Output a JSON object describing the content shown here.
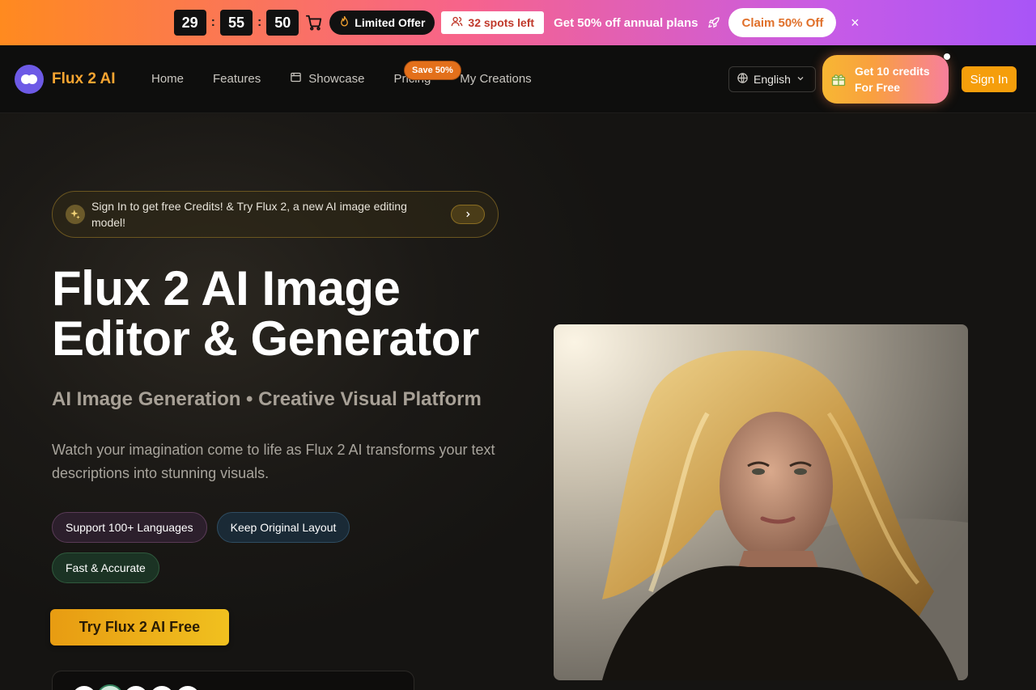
{
  "promo": {
    "timer": {
      "hours": "29",
      "minutes": "55",
      "seconds": "50",
      "separator": ":"
    },
    "offer_label": "Limited Offer",
    "spots_label": "32 spots left",
    "discount_text": "Get 50% off annual plans",
    "claim_label": "Claim 50% Off",
    "close_label": "×"
  },
  "nav": {
    "brand": "Flux 2 AI",
    "links": [
      "Home",
      "Features",
      "Showcase",
      "Pricing",
      "My Creations"
    ],
    "save_badge": "Save 50%",
    "language": "English",
    "credits_line1": "Get 10 credits",
    "credits_line2": "For Free",
    "signin_label": "Sign In"
  },
  "hero": {
    "notice": "Sign In to get free Credits! & Try Flux 2, a new AI image editing model!",
    "title_line1": "Flux 2 AI Image",
    "title_line2": "Editor & Generator",
    "subtitle": "AI Image Generation • Creative Visual Platform",
    "description": "Watch your imagination come to life as Flux 2 AI transforms your text descriptions into stunning visuals.",
    "tags": [
      "Support 100+ Languages",
      "Keep Original Layout",
      "Fast & Accurate"
    ],
    "cta_label": "Try Flux 2 AI Free"
  },
  "colors": {
    "brand_orange": "#f7a531",
    "signin_bg": "#f59e0b",
    "logo_purple": "#6d5ae6",
    "banner_start": "#ff8a1f",
    "banner_end": "#a855f7"
  },
  "icons": [
    "cart-icon",
    "flame-icon",
    "users-icon",
    "rocket-icon",
    "close-icon",
    "showcase-icon",
    "globe-icon",
    "chevron-down-icon",
    "gift-icon",
    "sparkle-icon",
    "chevron-right-icon"
  ]
}
